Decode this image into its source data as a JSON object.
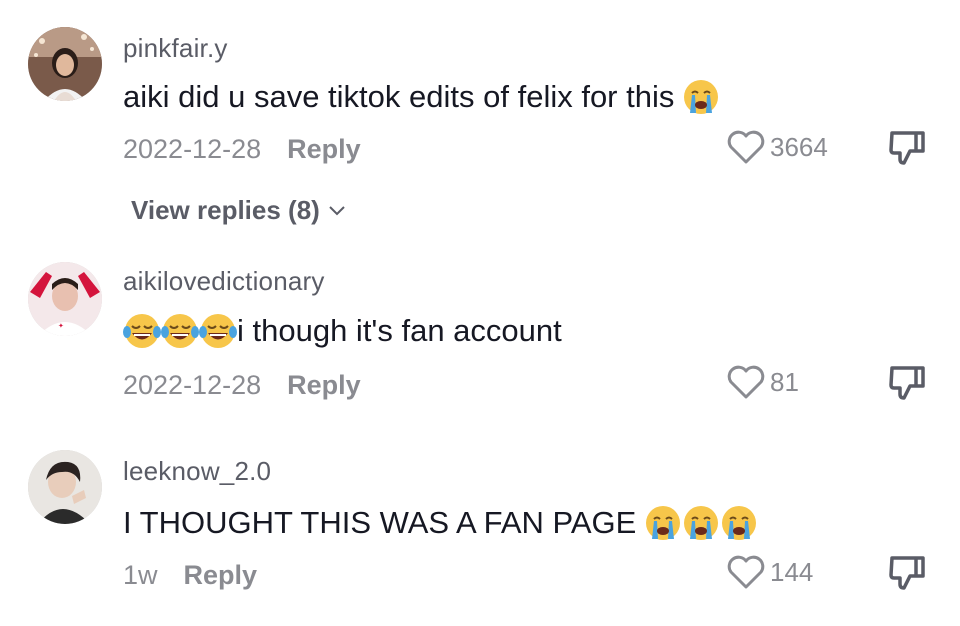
{
  "comments": [
    {
      "username": "pinkfair.y",
      "text": "aiki did u save tiktok edits of felix for this",
      "emojis": [
        "loudly-crying-face"
      ],
      "date": "2022-12-28",
      "reply_label": "Reply",
      "likes": "3664",
      "view_replies": "View replies (8)"
    },
    {
      "username": "aikilovedictionary",
      "emojis_before": [
        "tears-of-joy-face",
        "tears-of-joy-face",
        "tears-of-joy-face"
      ],
      "text": "i though it's fan account",
      "date": "2022-12-28",
      "reply_label": "Reply",
      "likes": "81"
    },
    {
      "username": "leeknow_2.0",
      "text": "I THOUGHT THIS WAS A FAN PAGE",
      "emojis": [
        "loudly-crying-face",
        "loudly-crying-face",
        "loudly-crying-face"
      ],
      "date": "1w",
      "reply_label": "Reply",
      "likes": "144"
    }
  ],
  "colors": {
    "text": "#161823",
    "username": "#5a5c66",
    "meta": "#8a8b91",
    "emoji_yellow": "#f7c64a",
    "emoji_tear": "#4aa3df"
  }
}
